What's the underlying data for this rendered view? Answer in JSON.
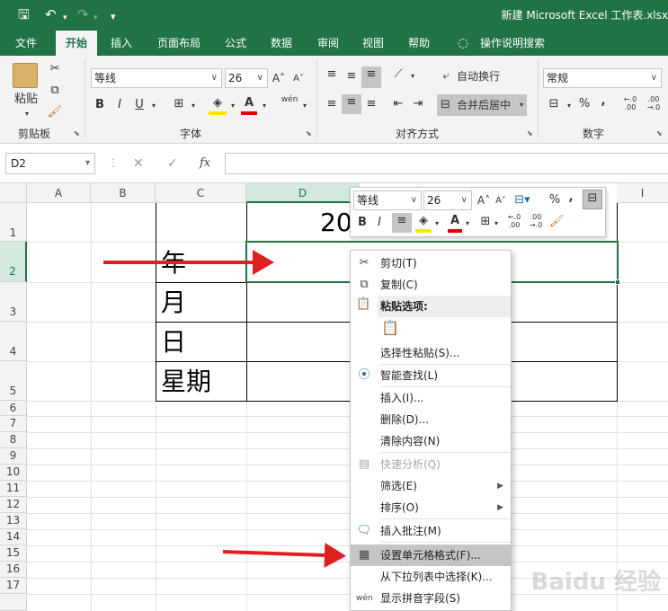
{
  "window": {
    "title": "新建 Microsoft Excel 工作表.xlsx"
  },
  "quick_access": {
    "save": "save-icon",
    "undo": "undo-icon",
    "redo": "redo-icon",
    "customize": "▾"
  },
  "tabs": [
    "文件",
    "开始",
    "插入",
    "页面布局",
    "公式",
    "数据",
    "审阅",
    "视图",
    "帮助"
  ],
  "tell_me": "操作说明搜索",
  "ribbon": {
    "clipboard": {
      "paste": "粘贴",
      "label": "剪贴板"
    },
    "font": {
      "name": "等线",
      "size": "26",
      "label": "字体",
      "bold": "B",
      "italic": "I",
      "underline": "U",
      "wen": "wén"
    },
    "alignment": {
      "wrap": "自动换行",
      "merge": "合并后居中",
      "label": "对齐方式"
    },
    "number": {
      "format": "常规",
      "label": "数字",
      "percent": "%",
      "comma": ","
    }
  },
  "formula_bar": {
    "name_box": "D2",
    "cancel": "✕",
    "enter": "✓",
    "fx": "fx",
    "value": ""
  },
  "columns": [
    "A",
    "B",
    "C",
    "D",
    "I"
  ],
  "rows": [
    "1",
    "2",
    "3",
    "4",
    "5",
    "6",
    "7",
    "8",
    "9",
    "10",
    "11",
    "12",
    "13",
    "14",
    "15",
    "16",
    "17"
  ],
  "cells": {
    "D1": "20",
    "C2": "年",
    "C3": "月",
    "C4": "日",
    "C5": "星期"
  },
  "mini_toolbar": {
    "font": "等线",
    "size": "26"
  },
  "context_menu": {
    "items": [
      {
        "label": "剪切(T)",
        "icon": "cut-icon"
      },
      {
        "label": "复制(C)",
        "icon": "copy-icon"
      },
      {
        "label": "粘贴选项:",
        "icon": "paste-icon"
      },
      {
        "label": "选择性粘贴(S)...",
        "icon": ""
      },
      {
        "label": "智能查找(L)",
        "icon": "smart-lookup-icon"
      },
      {
        "label": "插入(I)...",
        "icon": ""
      },
      {
        "label": "删除(D)...",
        "icon": ""
      },
      {
        "label": "清除内容(N)",
        "icon": ""
      },
      {
        "label": "快速分析(Q)",
        "icon": "quick-analysis-icon"
      },
      {
        "label": "筛选(E)",
        "icon": ""
      },
      {
        "label": "排序(O)",
        "icon": ""
      },
      {
        "label": "插入批注(M)",
        "icon": "comment-icon"
      },
      {
        "label": "设置单元格格式(F)...",
        "icon": "format-cells-icon"
      },
      {
        "label": "从下拉列表中选择(K)...",
        "icon": ""
      },
      {
        "label": "显示拼音字段(S)",
        "icon": "phonetic-icon"
      }
    ]
  },
  "watermark": "Baidu 经验"
}
